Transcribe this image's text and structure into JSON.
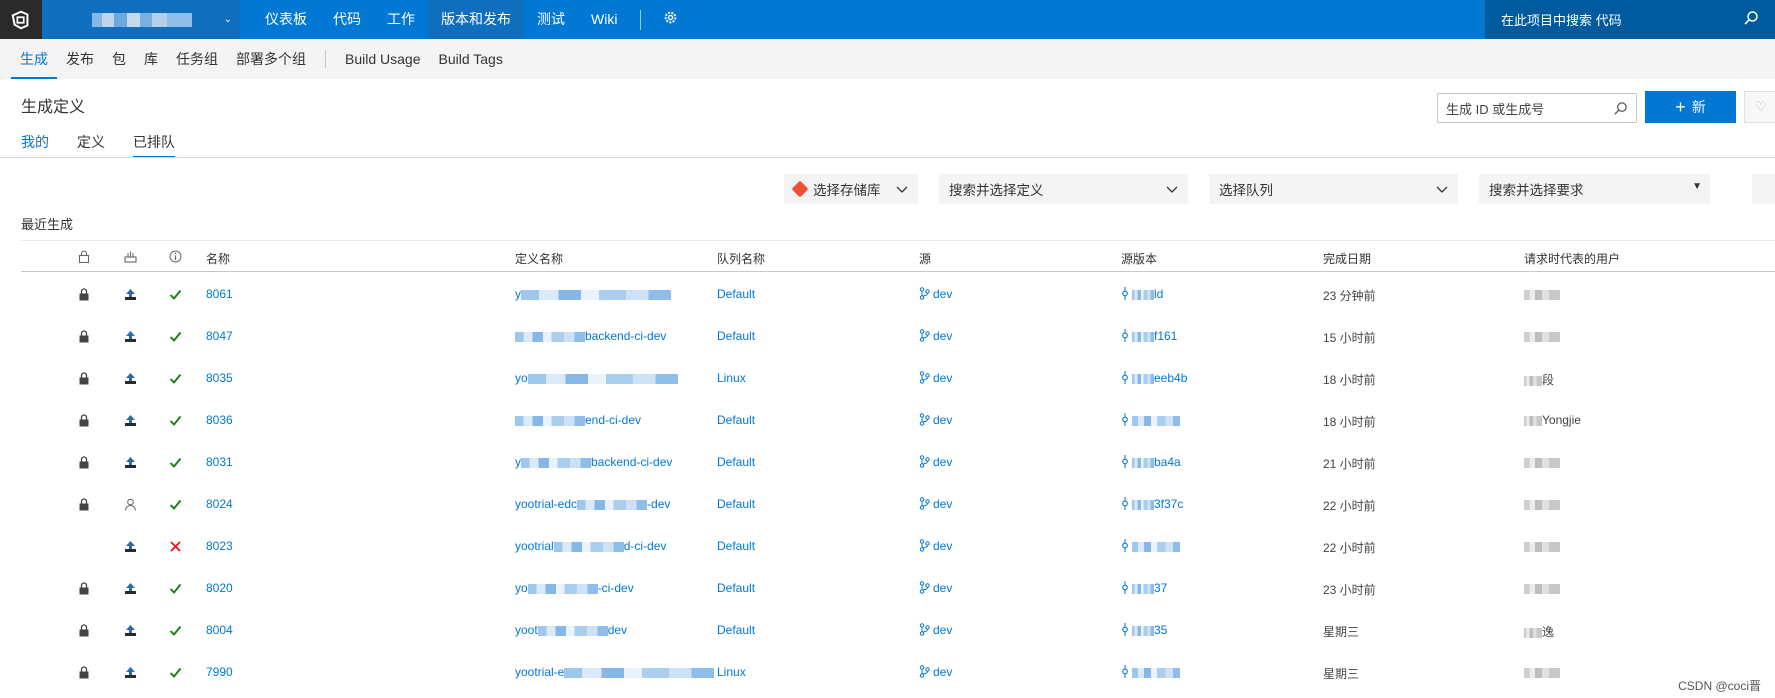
{
  "topbar": {
    "nav": [
      "仪表板",
      "代码",
      "工作",
      "版本和发布",
      "测试",
      "Wiki"
    ],
    "active_nav": "版本和发布",
    "search_placeholder": "在此项目中搜索 代码"
  },
  "subnav": {
    "items": [
      "生成",
      "发布",
      "包",
      "库",
      "任务组",
      "部署多个组"
    ],
    "extra": [
      "Build Usage",
      "Build Tags"
    ],
    "active": "生成"
  },
  "page": {
    "title": "生成定义",
    "id_search_placeholder": "生成 ID 或生成号",
    "new_button": "新",
    "pivots": [
      "我的",
      "定义",
      "已排队"
    ],
    "active_pivot": "已排队"
  },
  "filters": {
    "repo": "选择存储库",
    "definition": "搜索并选择定义",
    "queue": "选择队列",
    "demands": "搜索并选择要求"
  },
  "section_title": "最近生成",
  "table": {
    "headers": [
      "名称",
      "定义名称",
      "队列名称",
      "源",
      "源版本",
      "完成日期",
      "请求时代表的用户"
    ],
    "rows": [
      {
        "locked": true,
        "reason": "upload",
        "status": "success",
        "id": "8061",
        "def": "y",
        "def_tail": "",
        "queue": "Default",
        "source": "dev",
        "ver_tail": "ld",
        "date": "23 分钟前",
        "user": ""
      },
      {
        "locked": true,
        "reason": "upload",
        "status": "success",
        "id": "8047",
        "def": "",
        "def_tail": "backend-ci-dev",
        "queue": "Default",
        "source": "dev",
        "ver_tail": "f161",
        "date": "15 小时前",
        "user": ""
      },
      {
        "locked": true,
        "reason": "upload",
        "status": "success",
        "id": "8035",
        "def": "yo",
        "def_tail": "",
        "queue": "Linux",
        "source": "dev",
        "ver_tail": "eeb4b",
        "date": "18 小时前",
        "user": "段"
      },
      {
        "locked": true,
        "reason": "upload",
        "status": "success",
        "id": "8036",
        "def": "",
        "def_tail": "end-ci-dev",
        "queue": "Default",
        "source": "dev",
        "ver_tail": "",
        "date": "18 小时前",
        "user": "Yongjie"
      },
      {
        "locked": true,
        "reason": "upload",
        "status": "success",
        "id": "8031",
        "def": "y",
        "def_tail": "backend-ci-dev",
        "queue": "Default",
        "source": "dev",
        "ver_tail": "ba4a",
        "date": "21 小时前",
        "user": ""
      },
      {
        "locked": true,
        "reason": "user",
        "status": "success",
        "id": "8024",
        "def": "yootrial-edc",
        "def_tail": "-dev",
        "queue": "Default",
        "source": "dev",
        "ver_tail": "3f37c",
        "date": "22 小时前",
        "user": ""
      },
      {
        "locked": false,
        "reason": "upload",
        "status": "failed",
        "id": "8023",
        "def": "yootrial",
        "def_tail": "d-ci-dev",
        "queue": "Default",
        "source": "dev",
        "ver_tail": "",
        "date": "22 小时前",
        "user": ""
      },
      {
        "locked": true,
        "reason": "upload",
        "status": "success",
        "id": "8020",
        "def": "yo",
        "def_tail": "-ci-dev",
        "queue": "Default",
        "source": "dev",
        "ver_tail": "37",
        "date": "23 小时前",
        "user": ""
      },
      {
        "locked": true,
        "reason": "upload",
        "status": "success",
        "id": "8004",
        "def": "yoot",
        "def_tail": "dev",
        "queue": "Default",
        "source": "dev",
        "ver_tail": "35",
        "date": "星期三",
        "user": "逸"
      },
      {
        "locked": true,
        "reason": "upload",
        "status": "success",
        "id": "7990",
        "def": "yootrial-e",
        "def_tail": "",
        "queue": "Linux",
        "source": "dev",
        "ver_tail": "",
        "date": "星期三",
        "user": ""
      }
    ]
  },
  "watermark": "CSDN @coci晋",
  "colors": {
    "accent": "#0078d4",
    "topbar": "#0078d4",
    "success": "#107c10",
    "fail": "#e81123"
  }
}
